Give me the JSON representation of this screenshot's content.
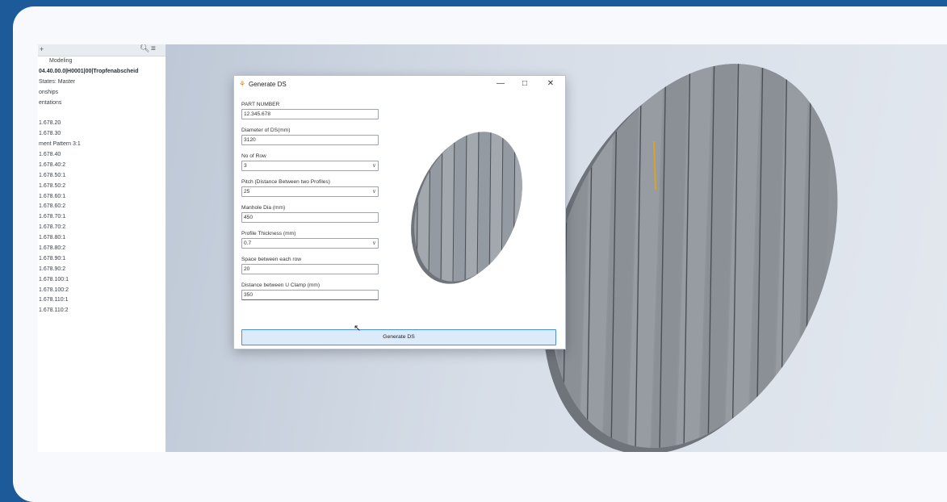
{
  "browser": {
    "tab_label": "Modeling",
    "items": [
      "04.40.00.0|H0001|00|Tropfenabscheid",
      "States: Master",
      "onships",
      "entations",
      "",
      "1.678.20",
      "1.678.30",
      "ment Pattern 3:1",
      "1.678.40",
      "1.678.40:2",
      "1.678.50:1",
      "1.678.50:2",
      "1.678.60:1",
      "1.678.60:2",
      "1.678.70:1",
      "1.678.70:2",
      "1.678.80:1",
      "1.678.80:2",
      "1.678.90:1",
      "1.678.90:2",
      "1.678.100:1",
      "1.678.100:2",
      "1.678.110:1",
      "1.678.110:2"
    ]
  },
  "dialog": {
    "title": "Generate DS",
    "fields": [
      {
        "label": "PART NUMBER",
        "value": "12.345.678",
        "type": "text"
      },
      {
        "label": "Diameter of DS(mm)",
        "value": "3120",
        "type": "text"
      },
      {
        "label": "No of Row",
        "value": "3",
        "type": "select"
      },
      {
        "label": "Pitch (Distance Between two Profiles)",
        "value": "25",
        "type": "select"
      },
      {
        "label": "Manhole Dia (mm)",
        "value": "450",
        "type": "text"
      },
      {
        "label": "Profile Thickness (mm)",
        "value": "0.7",
        "type": "select"
      },
      {
        "label": "Space between each row",
        "value": "20",
        "type": "text"
      },
      {
        "label": "Distance between U Clamp (mm)",
        "value": "350",
        "type": "text"
      }
    ],
    "generate_button": "Generate DS"
  },
  "icons": {
    "search": "search-icon",
    "menu": "hamburger-menu-icon",
    "minimize": "minimize-icon",
    "maximize": "maximize-icon",
    "close": "close-icon"
  },
  "colors": {
    "outer_background": "#1d5a9a",
    "button_fill": "#dcebfa",
    "button_border": "#4c8fd6",
    "model_gray": "#8a8f96"
  }
}
